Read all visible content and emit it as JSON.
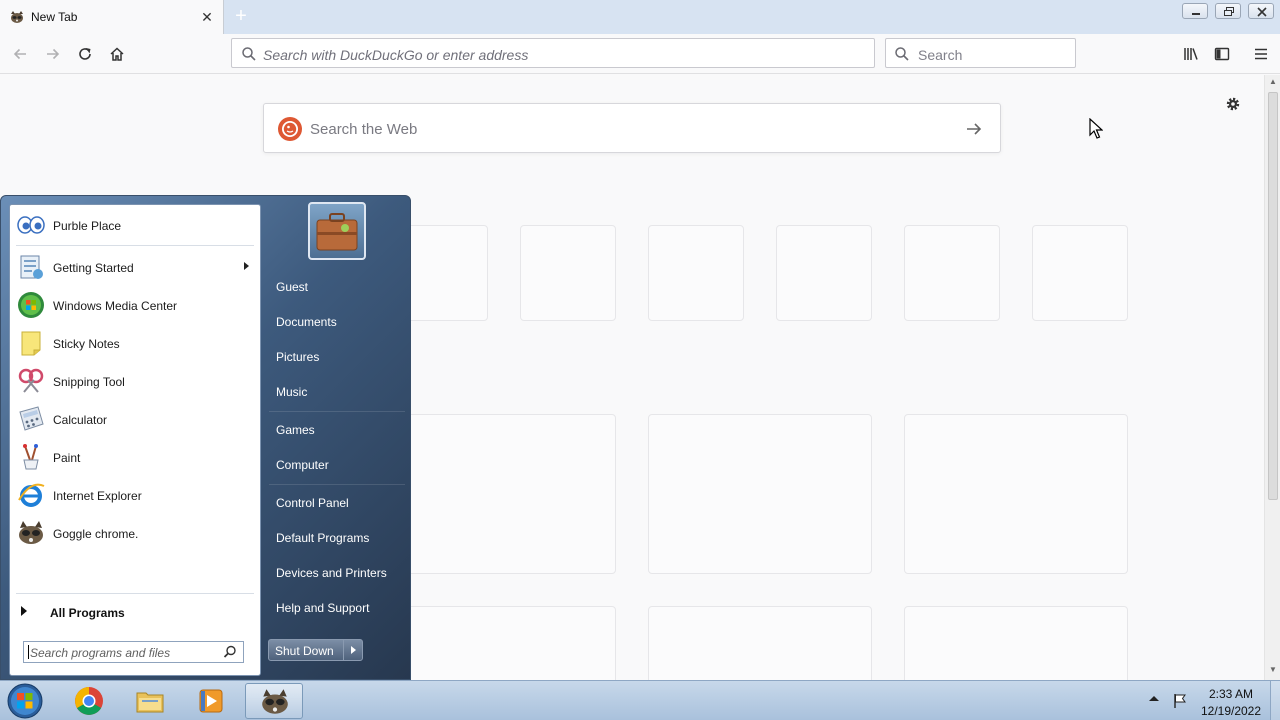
{
  "browser": {
    "tab_title": "New Tab",
    "url_placeholder": "Search with DuckDuckGo or enter address",
    "search_placeholder": "Search"
  },
  "newtab": {
    "web_search_placeholder": "Search the Web"
  },
  "start_menu": {
    "programs": [
      {
        "label": "Purble Place",
        "icon": "purble-place-icon"
      },
      {
        "label": "Getting Started",
        "icon": "getting-started-icon",
        "has_submenu": true
      },
      {
        "label": "Windows Media Center",
        "icon": "windows-media-center-icon"
      },
      {
        "label": "Sticky Notes",
        "icon": "sticky-notes-icon"
      },
      {
        "label": "Snipping Tool",
        "icon": "snipping-tool-icon"
      },
      {
        "label": "Calculator",
        "icon": "calculator-icon"
      },
      {
        "label": "Paint",
        "icon": "paint-icon"
      },
      {
        "label": "Internet Explorer",
        "icon": "internet-explorer-icon"
      },
      {
        "label": "Goggle chrome.",
        "icon": "goggle-chrome-icon"
      }
    ],
    "all_programs": "All Programs",
    "search_placeholder": "Search programs and files",
    "places": [
      "Guest",
      "Documents",
      "Pictures",
      "Music",
      "Games",
      "Computer",
      "Control Panel",
      "Default Programs",
      "Devices and Printers",
      "Help and Support"
    ],
    "shutdown_label": "Shut Down"
  },
  "taskbar": {
    "time": "2:33 AM",
    "date": "12/19/2022"
  },
  "colors": {
    "ddg_orange": "#de5833",
    "start_menu_dark": "#27384f",
    "taskbar_blue": "#a9c1dc"
  }
}
